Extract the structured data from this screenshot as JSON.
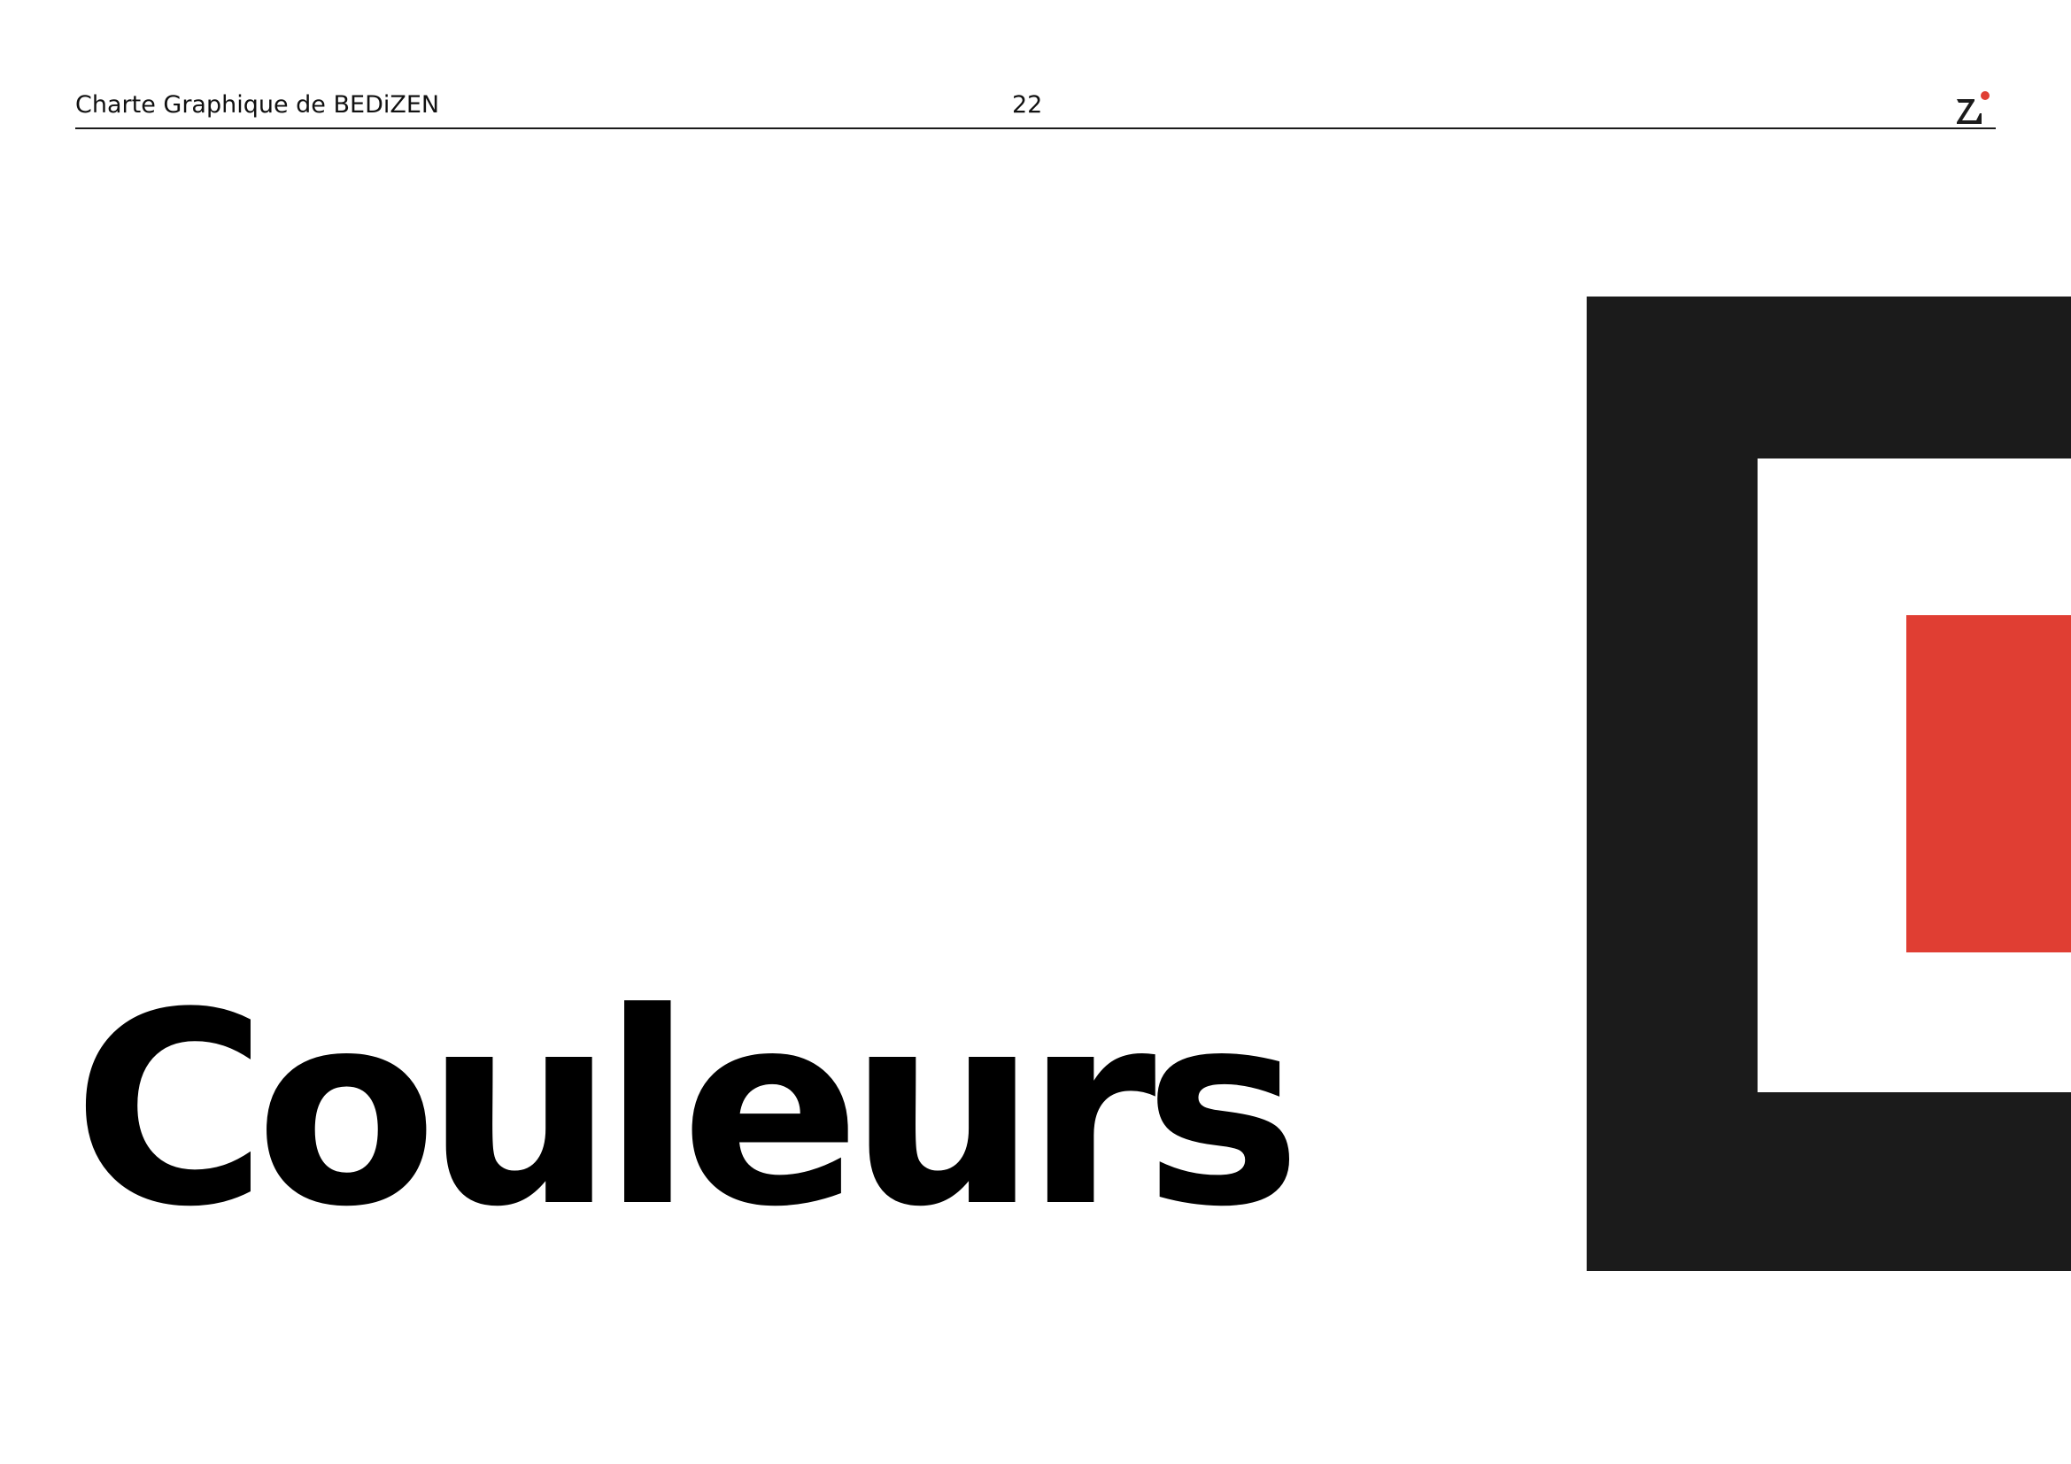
{
  "header": {
    "document_title": "Charte Graphique de BEDiZEN",
    "page_number": "22"
  },
  "main": {
    "section_title": "Couleurs"
  },
  "brand": {
    "logo_icon": "bedizen-logo-icon"
  },
  "colors": {
    "primary_dark": "#1b1b1b",
    "accent_red": "#e03e33",
    "background": "#ffffff"
  }
}
